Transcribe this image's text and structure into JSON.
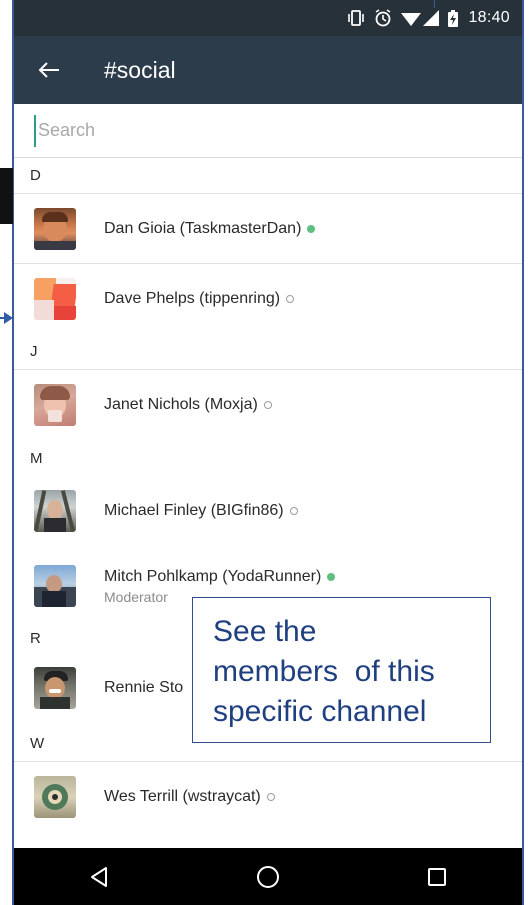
{
  "status_bar": {
    "time": "18:40",
    "icons": [
      "vibrate-icon",
      "alarm-icon",
      "wifi-icon",
      "signal-icon",
      "battery-charging-icon"
    ]
  },
  "app_bar": {
    "back_icon": "arrow-left-icon",
    "title": "#social"
  },
  "search": {
    "placeholder": "Search",
    "value": ""
  },
  "sections": [
    {
      "letter": "D",
      "members": [
        {
          "name": "Dan Gioia (TaskmasterDan)",
          "status": "online",
          "subtitle": ""
        },
        {
          "name": "Dave Phelps (tippenring)",
          "status": "away",
          "subtitle": ""
        }
      ]
    },
    {
      "letter": "J",
      "members": [
        {
          "name": "Janet Nichols (Moxja)",
          "status": "away",
          "subtitle": ""
        }
      ]
    },
    {
      "letter": "M",
      "members": [
        {
          "name": "Michael Finley (BIGfin86)",
          "status": "away",
          "subtitle": ""
        },
        {
          "name": "Mitch Pohlkamp (YodaRunner)",
          "status": "online",
          "subtitle": "Moderator"
        }
      ]
    },
    {
      "letter": "R",
      "members": [
        {
          "name": "Rennie Sto",
          "status": "",
          "subtitle": ""
        }
      ]
    },
    {
      "letter": "W",
      "members": [
        {
          "name": "Wes Terrill (wstraycat)",
          "status": "away",
          "subtitle": ""
        }
      ]
    }
  ],
  "callout": {
    "line1": "See the",
    "line2": "members  of this",
    "line3": "specific channel"
  },
  "nav_bar": {
    "icons": [
      "back-triangle-icon",
      "home-circle-icon",
      "recents-square-icon"
    ]
  },
  "colors": {
    "status_bar_bg": "#27313a",
    "app_bar_bg": "#2d3c4b",
    "online": "#5fbf7f",
    "callout_text": "#1f3f80",
    "callout_border": "#2f4f8c"
  }
}
